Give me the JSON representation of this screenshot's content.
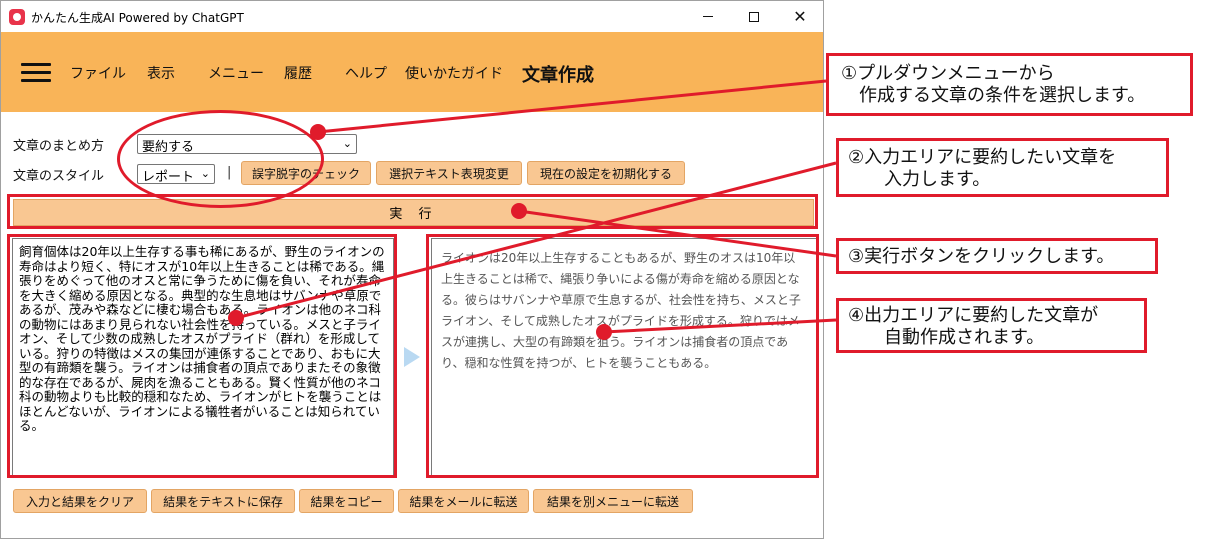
{
  "window": {
    "title": "かんたん生成AI Powered by ChatGPT"
  },
  "menu": {
    "items": [
      "ファイル",
      "表示",
      "メニュー",
      "履歴",
      "ヘルプ",
      "使いかたガイド"
    ],
    "page_title": "文章作成"
  },
  "controls": {
    "summary_label": "文章のまとめ方",
    "summary_value": "要約する",
    "style_label": "文章のスタイル",
    "style_value": "レポート",
    "separator": "|",
    "typo_check": "誤字脱字のチェック",
    "rephrase": "選択テキスト表現変更",
    "reset": "現在の設定を初期化する",
    "run": "実 行"
  },
  "input_text": "飼育個体は20年以上生存する事も稀にあるが、野生のライオンの寿命はより短く、特にオスが10年以上生きることは稀である。縄張りをめぐって他のオスと常に争うために傷を負い、それが寿命を大きく縮める原因となる。典型的な生息地はサバンナや草原であるが、茂みや森などに棲む場合もある。ライオンは他のネコ科の動物にはあまり見られない社会性を持っている。メスと子ライオン、そして少数の成熟したオスがプライド（群れ）を形成している。狩りの特徴はメスの集団が連係することであり、おもに大型の有蹄類を襲う。ライオンは捕食者の頂点でありまたその象徴的な存在であるが、屍肉を漁ることもある。賢く性質が他のネコ科の動物よりも比較的穏和なため、ライオンがヒトを襲うことはほとんどないが、ライオンによる犠牲者がいることは知られている。",
  "output_text": "ライオンは20年以上生存することもあるが、野生のオスは10年以上生きることは稀で、縄張り争いによる傷が寿命を縮める原因となる。彼らはサバンナや草原で生息するが、社会性を持ち、メスと子ライオン、そして成熟したオスがプライドを形成する。狩りではメスが連携し、大型の有蹄類を狙う。ライオンは捕食者の頂点であり、穏和な性質を持つが、ヒトを襲うこともある。",
  "bottom_buttons": [
    "入力と結果をクリア",
    "結果をテキストに保存",
    "結果をコピー",
    "結果をメールに転送",
    "結果を別メニューに転送"
  ],
  "annotations": {
    "a1": "①プルダウンメニューから\n　作成する文章の条件を選択します。",
    "a2": "②入力エリアに要約したい文章を\n　　入力します。",
    "a3": "③実行ボタンをクリックします。",
    "a4": "④出力エリアに要約した文章が\n　　自動作成されます。"
  },
  "colors": {
    "menubar": "#f9b458",
    "button": "#f9c792",
    "annotation_red": "#e01b2b"
  }
}
